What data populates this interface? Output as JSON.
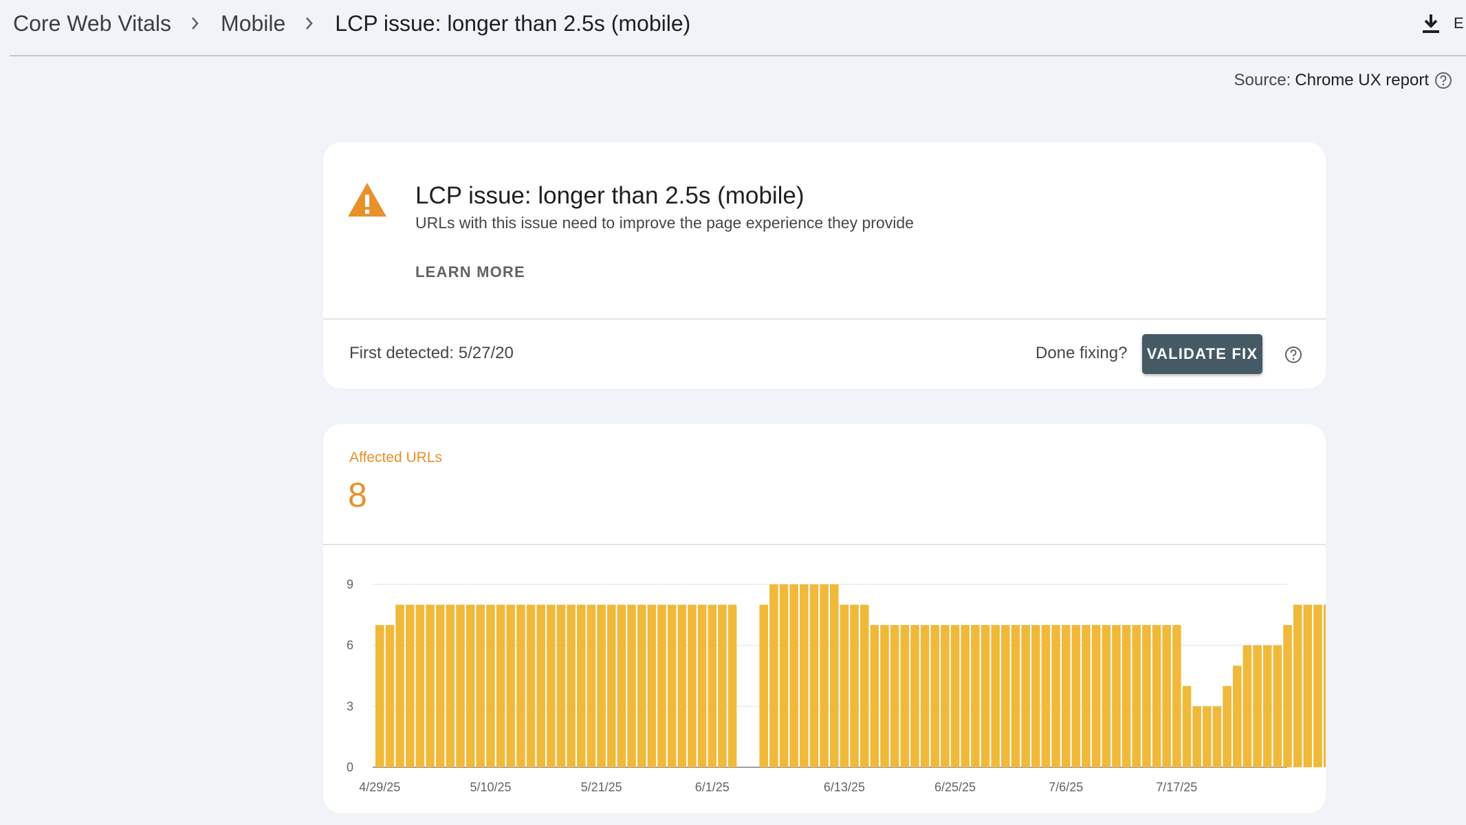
{
  "breadcrumb": {
    "items": [
      "Core Web Vitals",
      "Mobile"
    ],
    "current": "LCP issue: longer than 2.5s (mobile)"
  },
  "export": {
    "label": "E",
    "icon": "download-icon"
  },
  "source": {
    "label": "Source:",
    "value": "Chrome UX report",
    "icon": "help-circle-icon"
  },
  "issue": {
    "icon": "warning-icon",
    "title": "LCP issue: longer than 2.5s (mobile)",
    "description": "URLs with this issue need to improve the page experience they provide",
    "learn_more": "LEARN MORE",
    "first_detected": "First detected: 5/27/20",
    "done_fixing": "Done fixing?",
    "validate_fix": "VALIDATE FIX"
  },
  "affected": {
    "label": "Affected URLs",
    "value": "8"
  },
  "colors": {
    "bar": "#f0b93a",
    "affected_accent": "#e8902a",
    "warning_icon": "#e8912b",
    "validate_button": "#455a64"
  },
  "chart_data": {
    "type": "bar",
    "x_tick_labels": [
      "4/29/25",
      "5/10/25",
      "5/21/25",
      "6/1/25",
      "6/13/25",
      "6/25/25",
      "7/6/25",
      "7/17/25"
    ],
    "y_tick_labels": [
      "0",
      "3",
      "6",
      "9"
    ],
    "ylim": [
      0,
      9
    ],
    "grid": true,
    "gap_after_index": 35,
    "values": [
      7,
      7,
      8,
      8,
      8,
      8,
      8,
      8,
      8,
      8,
      8,
      8,
      8,
      8,
      8,
      8,
      8,
      8,
      8,
      8,
      8,
      8,
      8,
      8,
      8,
      8,
      8,
      8,
      8,
      8,
      8,
      8,
      8,
      8,
      8,
      8,
      8,
      9,
      9,
      9,
      9,
      9,
      9,
      9,
      8,
      8,
      8,
      7,
      7,
      7,
      7,
      7,
      7,
      7,
      7,
      7,
      7,
      7,
      7,
      7,
      7,
      7,
      7,
      7,
      7,
      7,
      7,
      7,
      7,
      7,
      7,
      7,
      7,
      7,
      7,
      7,
      7,
      7,
      4,
      3,
      3,
      3,
      4,
      5,
      6,
      6,
      6,
      6,
      7,
      8,
      8,
      8,
      8,
      8
    ]
  }
}
